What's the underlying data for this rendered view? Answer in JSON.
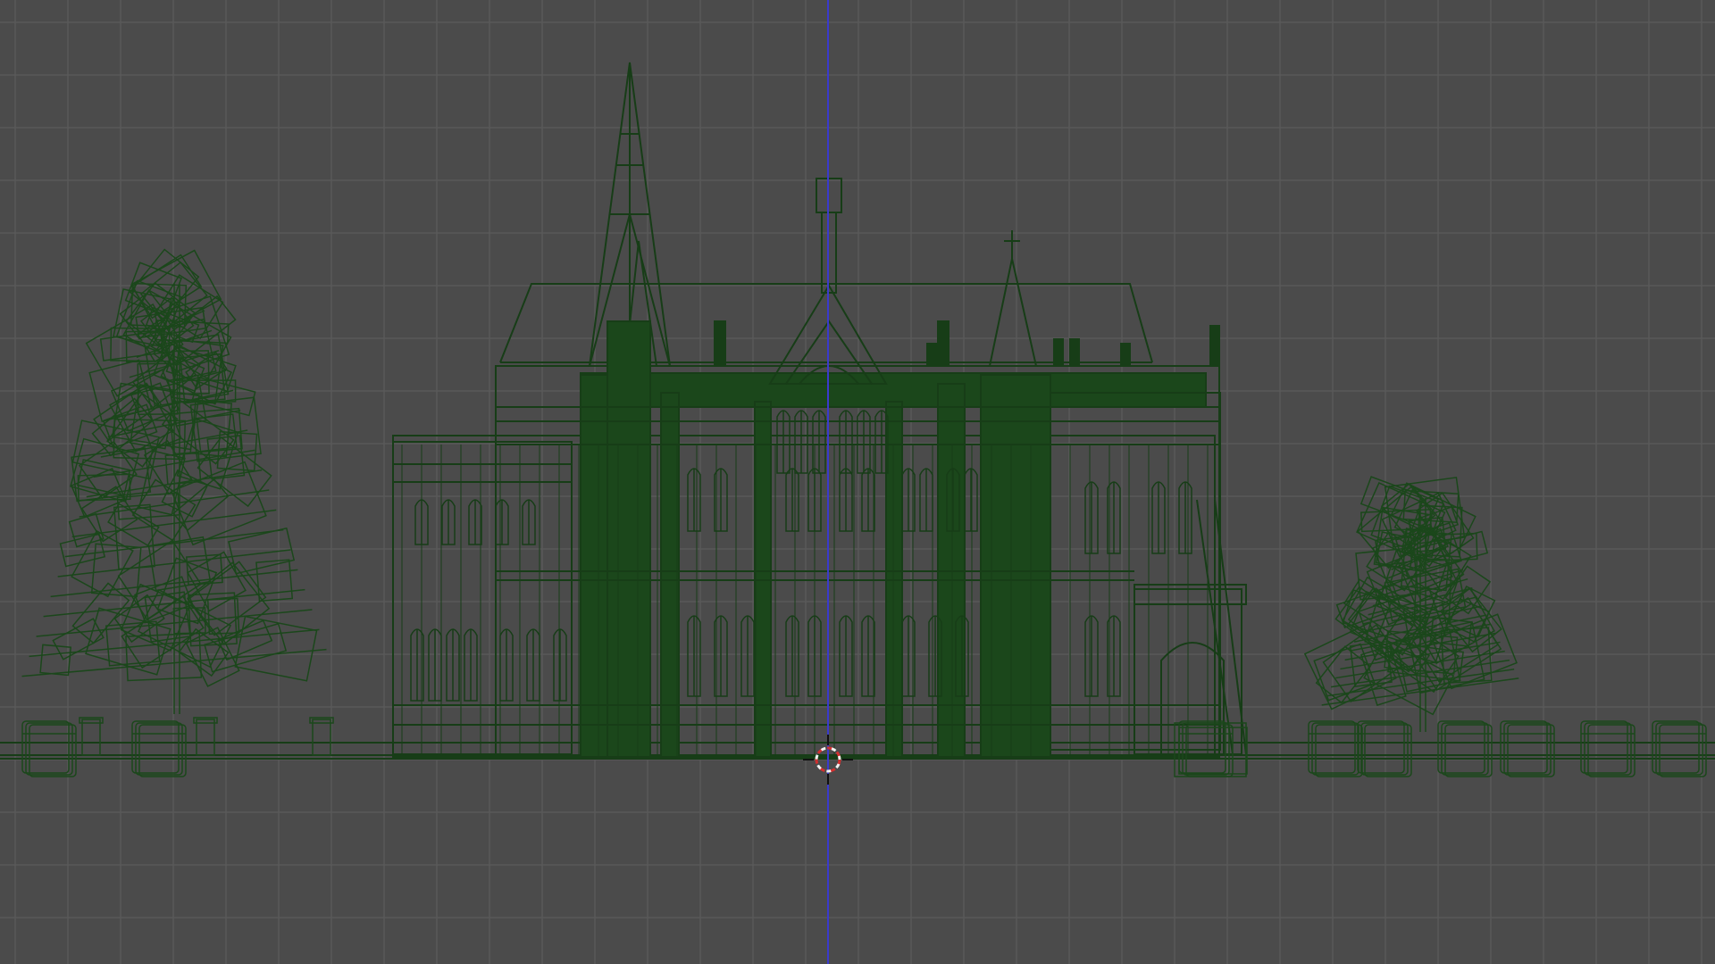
{
  "app": {
    "view": "front-orthographic",
    "mode": "wireframe"
  },
  "colors": {
    "viewport_background": "#4b4b4b",
    "grid_line": "#595959",
    "wire": "#173d17",
    "wire_dense": "#1b471b",
    "z_axis": "#3a3acc",
    "cursor_red": "#d23030",
    "cursor_white": "#f2f2f2"
  },
  "scene": {
    "objects": [
      {
        "name": "castle",
        "kind": "building"
      },
      {
        "name": "tree-left",
        "kind": "tree"
      },
      {
        "name": "tree-right",
        "kind": "tree"
      },
      {
        "name": "barrels",
        "kind": "props"
      },
      {
        "name": "ground-plane",
        "kind": "ground"
      }
    ],
    "grid_visible": true,
    "z_axis_visible": true,
    "cursor_3d_visible": true
  }
}
